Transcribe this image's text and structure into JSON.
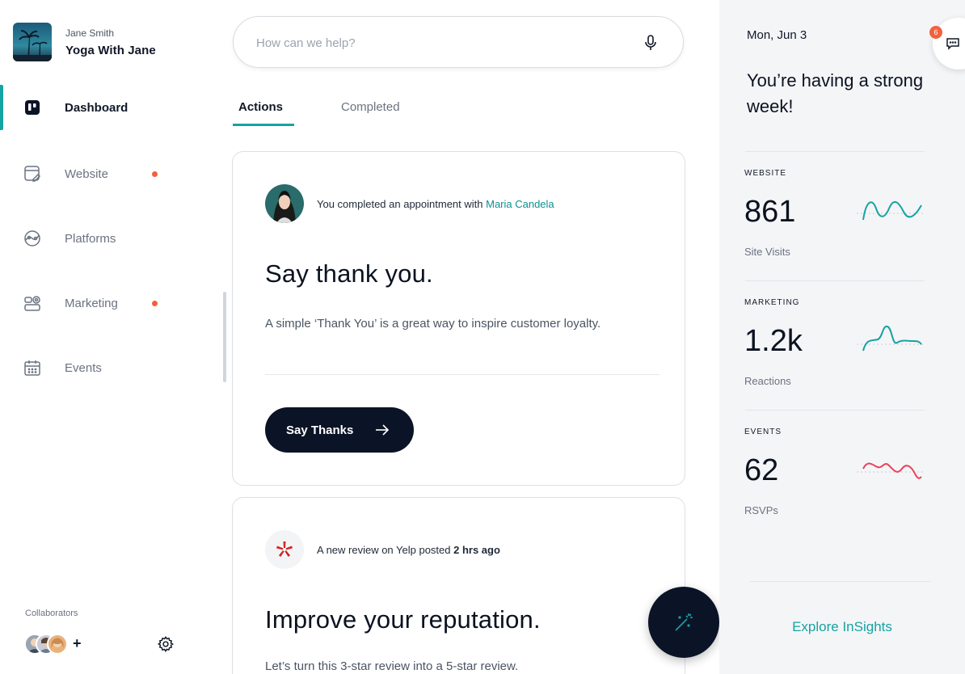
{
  "profile": {
    "user_name": "Jane Smith",
    "business_name": "Yoga With Jane"
  },
  "sidebar": {
    "items": [
      {
        "label": "Dashboard",
        "icon": "dashboard-icon",
        "active": true,
        "badge": false
      },
      {
        "label": "Website",
        "icon": "website-edit-icon",
        "active": false,
        "badge": true
      },
      {
        "label": "Platforms",
        "icon": "platforms-icon",
        "active": false,
        "badge": false
      },
      {
        "label": "Marketing",
        "icon": "marketing-icon",
        "active": false,
        "badge": true
      },
      {
        "label": "Events",
        "icon": "calendar-icon",
        "active": false,
        "badge": false
      }
    ],
    "collaborators_label": "Collaborators",
    "add_collaborator": "+"
  },
  "search": {
    "placeholder": "How can we help?",
    "value": ""
  },
  "tabs": [
    {
      "label": "Actions",
      "active": true
    },
    {
      "label": "Completed",
      "active": false
    }
  ],
  "cards": [
    {
      "head_text": "You completed an appointment with ",
      "head_link": "Maria Candela",
      "title": "Say thank you.",
      "description": "A simple ‘Thank You’ is a great way to inspire customer loyalty.",
      "cta_label": "Say Thanks"
    },
    {
      "head_text": "A new review on Yelp posted ",
      "head_strong": "2 hrs ago",
      "title": "Improve your reputation.",
      "description": "Let’s turn this 3-star review into a 5-star review."
    }
  ],
  "insights": {
    "date": "Mon, Jun 3",
    "headline": "You’re having a strong week!",
    "stats": [
      {
        "label": "WEBSITE",
        "value": "861",
        "caption": "Site Visits",
        "color": "#16a3a3"
      },
      {
        "label": "MARKETING",
        "value": "1.2k",
        "caption": "Reactions",
        "color": "#16a3a3"
      },
      {
        "label": "EVENTS",
        "value": "62",
        "caption": "RSVPs",
        "color": "#e8445a"
      }
    ],
    "explore_label": "Explore InSights"
  },
  "chat": {
    "badge_count": "6"
  },
  "colors": {
    "accent": "#16a3a3",
    "notification": "#f2613f",
    "dark": "#0b1426",
    "events": "#e8445a"
  }
}
